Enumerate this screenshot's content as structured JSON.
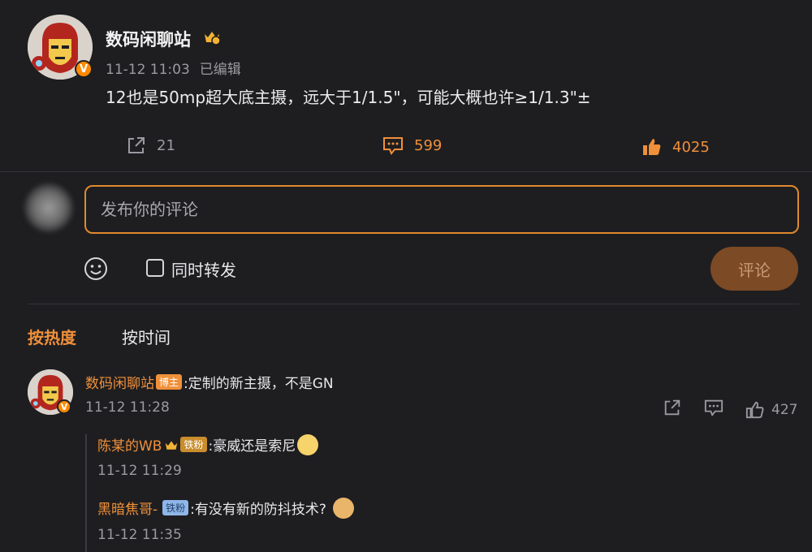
{
  "post": {
    "author": "数码闲聊站",
    "time": "11-12 11:03",
    "edited": "已编辑",
    "text": "12也是50mp超大底主摄，远大于1/1.5\"，可能大概也许≥1/1.3\"±",
    "verified_mark": "V",
    "shares": "21",
    "comments": "599",
    "likes": "4025"
  },
  "composer": {
    "placeholder": "发布你的评论",
    "repost_label": "同时转发",
    "submit_label": "评论"
  },
  "sort_tabs": {
    "hot": "按热度",
    "time": "按时间"
  },
  "comments": [
    {
      "author": "数码闲聊站",
      "badge": "博主",
      "text": ":定制的新主摄，不是GN",
      "time": "11-12 11:28",
      "likes": "427",
      "verified_mark": "V",
      "replies": [
        {
          "author": "陈某的WB",
          "badge": "铁粉",
          "text": ":豪威还是索尼",
          "time": "11-12 11:29"
        },
        {
          "author": "黑暗焦哥-",
          "badge": "铁粉",
          "text": ":有没有新的防抖技术?",
          "time": "11-12 11:35"
        }
      ]
    }
  ],
  "colors": {
    "accent": "#f0903a",
    "background": "#1e1e21",
    "submit_bg": "#7c4a24"
  },
  "icons": {
    "share": "share-icon",
    "comment": "comment-icon",
    "like": "thumbs-up-icon",
    "emoji": "emoji-smile-icon",
    "crown": "crown-icon"
  }
}
